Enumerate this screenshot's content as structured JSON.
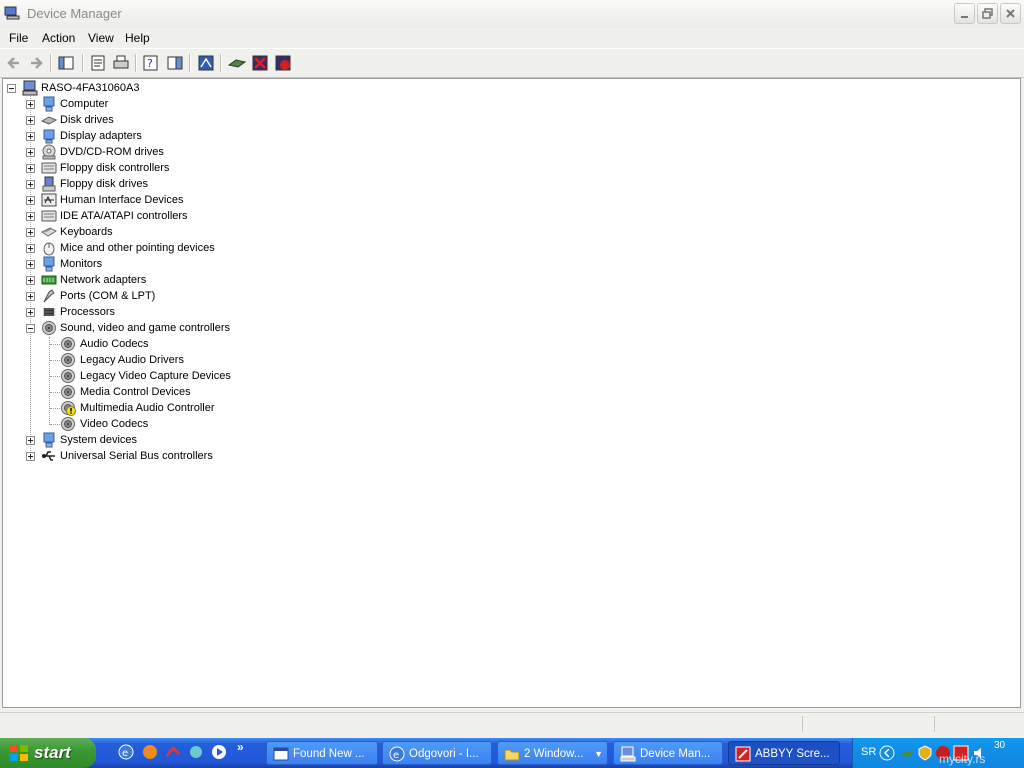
{
  "window": {
    "title": "Device Manager"
  },
  "menu": [
    "File",
    "Action",
    "View",
    "Help"
  ],
  "tree": {
    "root": "RASO-4FA31060A3",
    "categories": [
      {
        "label": "Computer",
        "icon": "computer-icon"
      },
      {
        "label": "Disk drives",
        "icon": "disk-drive-icon"
      },
      {
        "label": "Display adapters",
        "icon": "display-adapter-icon"
      },
      {
        "label": "DVD/CD-ROM drives",
        "icon": "cdrom-icon"
      },
      {
        "label": "Floppy disk controllers",
        "icon": "controller-icon"
      },
      {
        "label": "Floppy disk drives",
        "icon": "floppy-icon"
      },
      {
        "label": "Human Interface Devices",
        "icon": "hid-icon"
      },
      {
        "label": "IDE ATA/ATAPI controllers",
        "icon": "controller-icon"
      },
      {
        "label": "Keyboards",
        "icon": "keyboard-icon"
      },
      {
        "label": "Mice and other pointing devices",
        "icon": "mouse-icon"
      },
      {
        "label": "Monitors",
        "icon": "monitor-icon"
      },
      {
        "label": "Network adapters",
        "icon": "network-adapter-icon"
      },
      {
        "label": "Ports (COM & LPT)",
        "icon": "port-icon"
      },
      {
        "label": "Processors",
        "icon": "processor-icon"
      },
      {
        "label": "Sound, video and game controllers",
        "icon": "speaker-icon",
        "expanded": true
      },
      {
        "label": "System devices",
        "icon": "system-device-icon"
      },
      {
        "label": "Universal Serial Bus controllers",
        "icon": "usb-icon"
      }
    ],
    "sound_children": [
      {
        "label": "Audio Codecs",
        "icon": "speaker-icon"
      },
      {
        "label": "Legacy Audio Drivers",
        "icon": "speaker-icon"
      },
      {
        "label": "Legacy Video Capture Devices",
        "icon": "speaker-icon"
      },
      {
        "label": "Media Control Devices",
        "icon": "speaker-icon"
      },
      {
        "label": "Multimedia Audio Controller",
        "icon": "warning-speaker-icon"
      },
      {
        "label": "Video Codecs",
        "icon": "speaker-icon"
      }
    ]
  },
  "taskbar": {
    "start_label": "start",
    "tasks": [
      {
        "label": "Found New ...",
        "icon": "window-icon"
      },
      {
        "label": "Odgovori - I...",
        "icon": "ie-icon"
      },
      {
        "label": "2 Window...",
        "icon": "folder-icon",
        "count": "2"
      },
      {
        "label": "Device Man...",
        "icon": "device-manager-icon"
      },
      {
        "label": "ABBYY Scre...",
        "icon": "abbyy-icon",
        "active": true
      }
    ],
    "tray": {
      "lang": "SR",
      "clock": "30",
      "watermark": "mycity.rs"
    }
  },
  "colors": {
    "taskbar": "#245edb",
    "start": "#3c9a34",
    "tray": "#0f86e0",
    "selection": "#316ac5"
  }
}
